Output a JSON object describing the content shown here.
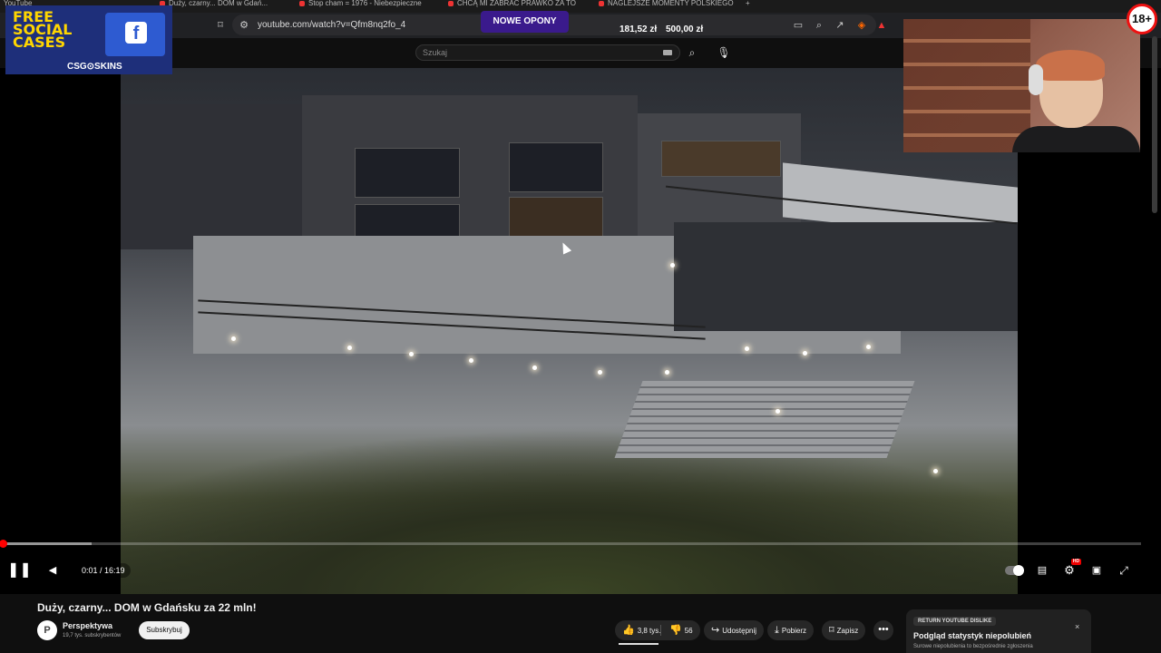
{
  "browser": {
    "tabs": [
      "YouTube",
      "Duży, czarny... DOM w Gdań...",
      "Stop cham = 1976 - Niebezpieczne",
      "CHCĄ MI ZABRAĆ PRAWKO ZA TO",
      "NAGLEJSZE MOMENTY POLSKIEGO"
    ],
    "url": "youtube.com/watch?v=Qfm8nq2fo_4"
  },
  "ad": {
    "line1": "FREE",
    "line2": "SOCIAL",
    "line3": "CASES",
    "fb_letter": "f",
    "brand": "CSG⊙SKINS"
  },
  "stream_overlay": {
    "promo": "NOWE OPONY",
    "price1": "181,52 zł",
    "price2": "500,00 zł",
    "age_badge": "18+"
  },
  "search": {
    "placeholder": "Szukaj"
  },
  "player": {
    "time": "0:01 / 16:19",
    "progress": 0.001,
    "buffered": 0.08
  },
  "video": {
    "title": "Duży, czarny... DOM w Gdańsku za 22 mln!",
    "channel": "Perspektywa",
    "channel_initial": "P",
    "subscribers": "19,7 tys. subskrybentów",
    "subscribe_label": "Subskrybuj",
    "likes": "3,8 tys.",
    "dislikes": "56",
    "share_label": "Udostępnij",
    "download_label": "Pobierz",
    "save_label": "Zapisz"
  },
  "ryd": {
    "tag": "RETURN YOUTUBE DISLIKE",
    "title": "Podgląd statystyk niepolubień",
    "subtitle": "Surowe niepolubienia to bezpośrednie zgłoszenia",
    "close": "×"
  }
}
